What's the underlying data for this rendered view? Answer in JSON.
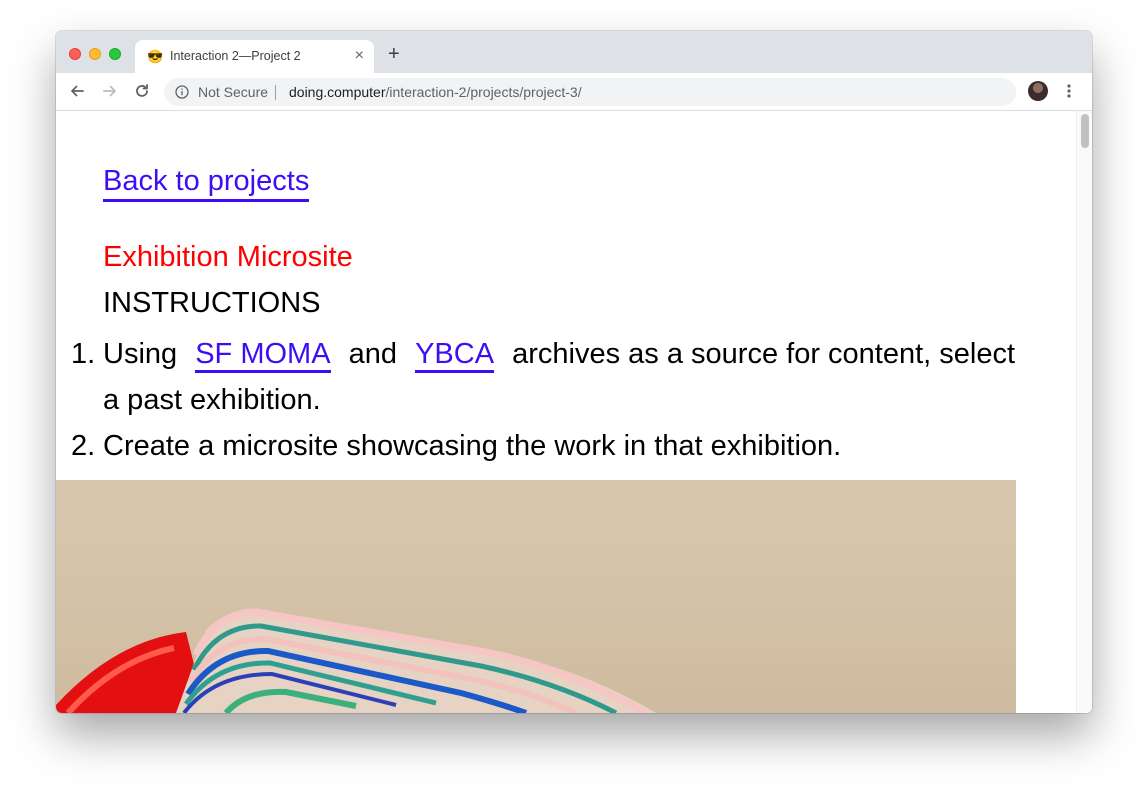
{
  "browser": {
    "tab": {
      "favicon": "😎",
      "title": "Interaction 2—Project 2",
      "close": "×"
    },
    "new_tab": "+",
    "omnibox": {
      "security_label": "Not Secure",
      "url_host": "doing.computer",
      "url_path": "/interaction-2/projects/project-3/"
    }
  },
  "page": {
    "back_link": "Back to projects",
    "project_title": "Exhibition Microsite",
    "instructions_heading": "INSTRUCTIONS",
    "list": [
      {
        "number": "1.",
        "before": "Using",
        "link1": "SF MOMA",
        "middle": "and",
        "link2": "YBCA",
        "after": "archives as a source for content, select a past exhibition."
      },
      {
        "number": "2.",
        "text": "Create a microsite showcasing the work in that exhibition."
      }
    ],
    "accent_color": "#3d0ef5",
    "title_color": "#ff0000"
  }
}
